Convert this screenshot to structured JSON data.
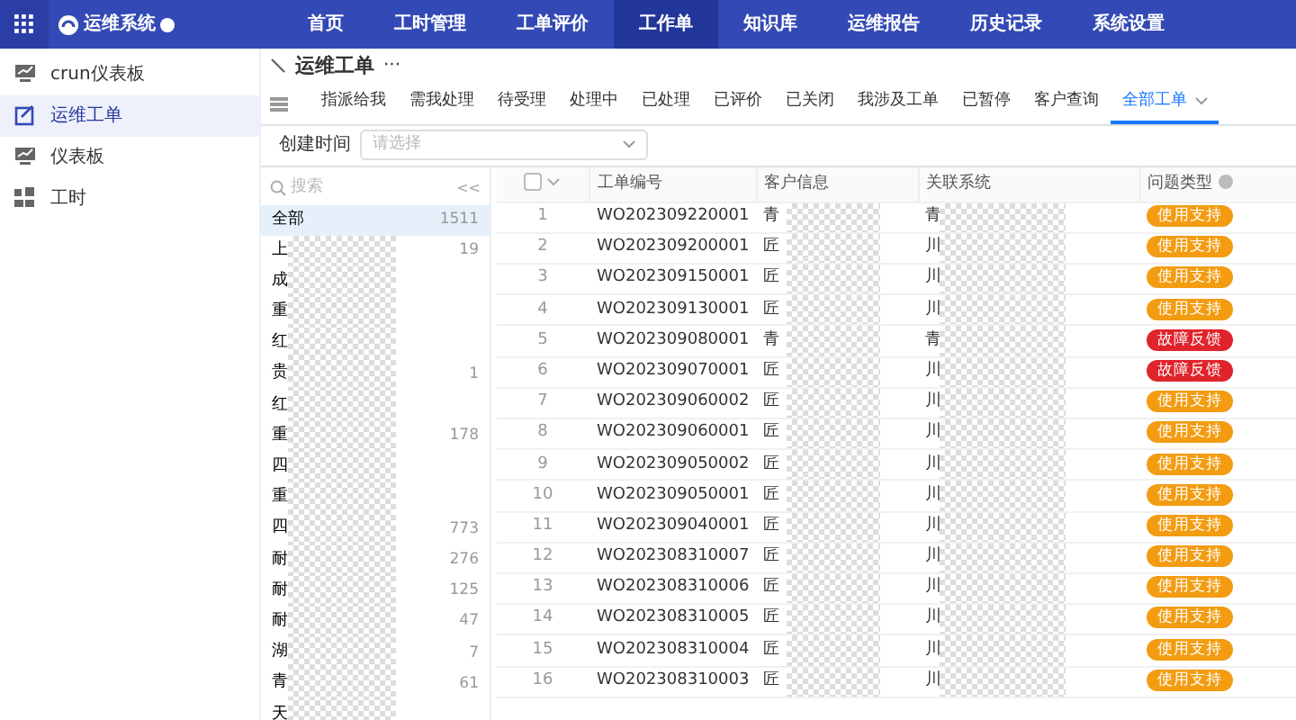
{
  "app": {
    "title": "运维系统"
  },
  "nav": [
    {
      "label": "首页",
      "selected": false
    },
    {
      "label": "工时管理",
      "selected": false
    },
    {
      "label": "工单评价",
      "selected": false
    },
    {
      "label": "工作单",
      "selected": true
    },
    {
      "label": "知识库",
      "selected": false
    },
    {
      "label": "运维报告",
      "selected": false
    },
    {
      "label": "历史记录",
      "selected": false
    },
    {
      "label": "系统设置",
      "selected": false
    }
  ],
  "sidebar": {
    "items": [
      {
        "label": "crun仪表板",
        "kind": "dashboard",
        "selected": false
      },
      {
        "label": "运维工单",
        "kind": "ticket",
        "selected": true
      },
      {
        "label": "仪表板",
        "kind": "dashboard",
        "selected": false
      },
      {
        "label": "工时",
        "kind": "hours",
        "selected": false
      }
    ]
  },
  "page": {
    "title": "运维工单",
    "more": "···"
  },
  "tabs": [
    {
      "label": "指派给我",
      "selected": false
    },
    {
      "label": "需我处理",
      "selected": false
    },
    {
      "label": "待受理",
      "selected": false
    },
    {
      "label": "处理中",
      "selected": false
    },
    {
      "label": "已处理",
      "selected": false
    },
    {
      "label": "已评价",
      "selected": false
    },
    {
      "label": "已关闭",
      "selected": false
    },
    {
      "label": "我涉及工单",
      "selected": false
    },
    {
      "label": "已暂停",
      "selected": false
    },
    {
      "label": "客户查询",
      "selected": false
    },
    {
      "label": "全部工单",
      "selected": true
    }
  ],
  "filter": {
    "label": "创建时间",
    "placeholder": "请选择"
  },
  "tree": {
    "search_placeholder": "搜索",
    "collapse": "<<",
    "items": [
      {
        "label": "全部",
        "count": "1511",
        "selected": true
      },
      {
        "label": "上",
        "count": "19",
        "selected": false
      },
      {
        "label": "成",
        "selected": false
      },
      {
        "label": "重",
        "selected": false
      },
      {
        "label": "红",
        "selected": false
      },
      {
        "label": "贵",
        "count": "1",
        "selected": false
      },
      {
        "label": "红",
        "selected": false
      },
      {
        "label": "重",
        "count": "178",
        "selected": false
      },
      {
        "label": "四",
        "selected": false
      },
      {
        "label": "重",
        "selected": false
      },
      {
        "label": "四",
        "count": "773",
        "selected": false
      },
      {
        "label": "耐",
        "count": "276",
        "selected": false
      },
      {
        "label": "耐",
        "count": "125",
        "selected": false
      },
      {
        "label": "耐",
        "count": "47",
        "selected": false
      },
      {
        "label": "湖",
        "count": "7",
        "selected": false
      },
      {
        "label": "青",
        "count": "61",
        "selected": false
      },
      {
        "label": "天",
        "selected": false
      }
    ]
  },
  "table": {
    "select_all": {
      "checked": false
    },
    "columns": [
      "工单编号",
      "客户信息",
      "关联系统",
      "问题类型"
    ],
    "rows": [
      {
        "no": "1",
        "id": "WO202309220001",
        "customer": "青",
        "system": "青",
        "type": "使用支持",
        "color": "#f39c12"
      },
      {
        "no": "2",
        "id": "WO202309200001",
        "customer": "匠",
        "system": "川",
        "type": "使用支持",
        "color": "#f39c12"
      },
      {
        "no": "3",
        "id": "WO202309150001",
        "customer": "匠",
        "system": "川",
        "type": "使用支持",
        "color": "#f39c12"
      },
      {
        "no": "4",
        "id": "WO202309130001",
        "customer": "匠",
        "system": "川",
        "type": "使用支持",
        "color": "#f39c12"
      },
      {
        "no": "5",
        "id": "WO202309080001",
        "customer": "青",
        "system": "青",
        "type": "故障反馈",
        "color": "#e0242c"
      },
      {
        "no": "6",
        "id": "WO202309070001",
        "customer": "匠",
        "system": "川",
        "type": "故障反馈",
        "color": "#e0242c"
      },
      {
        "no": "7",
        "id": "WO202309060002",
        "customer": "匠",
        "system": "川",
        "type": "使用支持",
        "color": "#f39c12"
      },
      {
        "no": "8",
        "id": "WO202309060001",
        "customer": "匠",
        "system": "川",
        "type": "使用支持",
        "color": "#f39c12"
      },
      {
        "no": "9",
        "id": "WO202309050002",
        "customer": "匠",
        "system": "川",
        "type": "使用支持",
        "color": "#f39c12"
      },
      {
        "no": "10",
        "id": "WO202309050001",
        "customer": "匠",
        "system": "川",
        "type": "使用支持",
        "color": "#f39c12"
      },
      {
        "no": "11",
        "id": "WO202309040001",
        "customer": "匠",
        "system": "川",
        "type": "使用支持",
        "color": "#f39c12"
      },
      {
        "no": "12",
        "id": "WO202308310007",
        "customer": "匠",
        "system": "川",
        "type": "使用支持",
        "color": "#f39c12"
      },
      {
        "no": "13",
        "id": "WO202308310006",
        "customer": "匠",
        "system": "川",
        "type": "使用支持",
        "color": "#f39c12"
      },
      {
        "no": "14",
        "id": "WO202308310005",
        "customer": "匠",
        "system": "川",
        "type": "使用支持",
        "color": "#f39c12"
      },
      {
        "no": "15",
        "id": "WO202308310004",
        "customer": "匠",
        "system": "川",
        "type": "使用支持",
        "color": "#f39c12"
      },
      {
        "no": "16",
        "id": "WO202308310003",
        "customer": "匠",
        "system": "川",
        "type": "使用支持",
        "color": "#f39c12"
      }
    ]
  }
}
